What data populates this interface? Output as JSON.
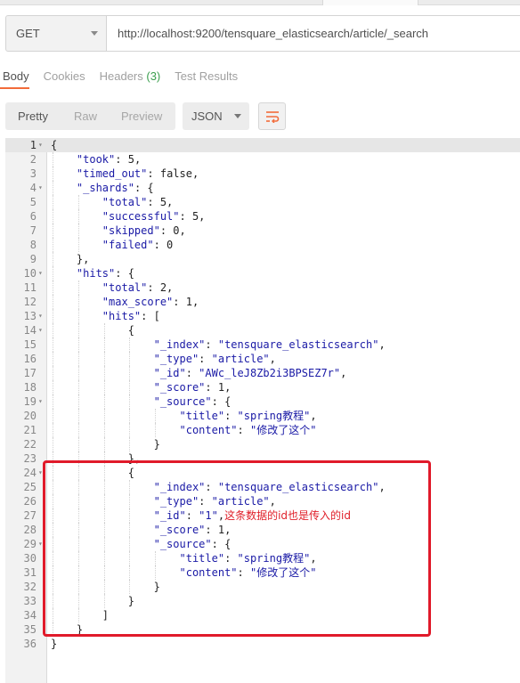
{
  "request": {
    "method": "GET",
    "url": "http://localhost:9200/tensquare_elasticsearch/article/_search"
  },
  "response_tabs": [
    {
      "label": "Body",
      "count": ""
    },
    {
      "label": "Cookies",
      "count": ""
    },
    {
      "label": "Headers",
      "count": "(3)"
    },
    {
      "label": "Test Results",
      "count": ""
    }
  ],
  "toolbar": {
    "views": [
      "Pretty",
      "Raw",
      "Preview"
    ],
    "format": "JSON",
    "wrap_icon": "wrap-lines-icon"
  },
  "annotation": "这条数据的id也是传入的id",
  "code_lines": [
    "{",
    "    \"took\": 5,",
    "    \"timed_out\": false,",
    "    \"_shards\": {",
    "        \"total\": 5,",
    "        \"successful\": 5,",
    "        \"skipped\": 0,",
    "        \"failed\": 0",
    "    },",
    "    \"hits\": {",
    "        \"total\": 2,",
    "        \"max_score\": 1,",
    "        \"hits\": [",
    "            {",
    "                \"_index\": \"tensquare_elasticsearch\",",
    "                \"_type\": \"article\",",
    "                \"_id\": \"AWc_leJ8Zb2i3BPSEZ7r\",",
    "                \"_score\": 1,",
    "                \"_source\": {",
    "                    \"title\": \"spring教程\",",
    "                    \"content\": \"修改了这个\"",
    "                }",
    "            },",
    "            {",
    "                \"_index\": \"tensquare_elasticsearch\",",
    "                \"_type\": \"article\",",
    "                \"_id\": \"1\",",
    "                \"_score\": 1,",
    "                \"_source\": {",
    "                    \"title\": \"spring教程\",",
    "                    \"content\": \"修改了这个\"",
    "                }",
    "            }",
    "        ]",
    "    }",
    "}"
  ],
  "foldable_lines": [
    1,
    4,
    10,
    13,
    14,
    19,
    24,
    29
  ],
  "colors": {
    "accent": "#f26b3a",
    "headers_count": "#3a9e4d",
    "json_keys": "#1a1aa6",
    "highlight": "#e01a2a"
  }
}
